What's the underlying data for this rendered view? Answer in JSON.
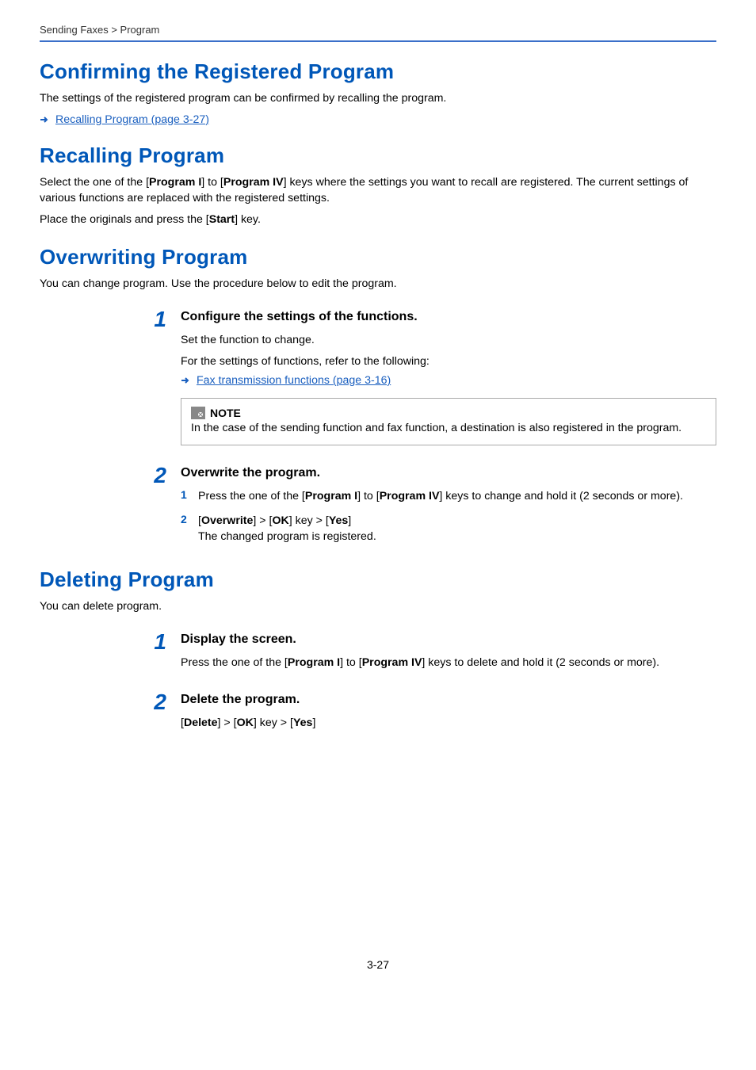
{
  "breadcrumb": "Sending Faxes > Program",
  "section_confirm": {
    "heading": "Confirming the Registered Program",
    "intro": "The settings of the registered program can be confirmed by recalling the program.",
    "link": "Recalling Program (page 3-27)"
  },
  "section_recall": {
    "heading": "Recalling Program",
    "para1_pre": "Select the one of the [",
    "para1_b1": "Program I",
    "para1_mid": "] to [",
    "para1_b2": "Program IV",
    "para1_post": "] keys where the settings you want to recall are registered. The current settings of various functions are replaced with the registered settings.",
    "para2_pre": "Place the originals and press the [",
    "para2_b1": "Start",
    "para2_post": "] key."
  },
  "section_overwrite": {
    "heading": "Overwriting Program",
    "intro": "You can change program. Use the procedure below to edit the program.",
    "step1": {
      "num": "1",
      "title": "Configure the settings of the functions.",
      "line1": "Set the function to change.",
      "line2": "For the settings of functions, refer to the following:",
      "link": "Fax transmission functions (page 3-16)",
      "note_label": "NOTE",
      "note_text": "In the case of the sending function and fax function, a destination is also registered in the program."
    },
    "step2": {
      "num": "2",
      "title": "Overwrite the program.",
      "sub1": {
        "num": "1",
        "pre": "Press the one of the [",
        "b1": "Program I",
        "mid": "] to [",
        "b2": "Program IV",
        "post": "] keys to change and hold it (2 seconds or more)."
      },
      "sub2": {
        "num": "2",
        "l1_open1": "[",
        "l1_b1": "Overwrite",
        "l1_sep1": "] > [",
        "l1_b2": "OK",
        "l1_sep2": "] key > [",
        "l1_b3": "Yes",
        "l1_close": "]",
        "l2": "The changed program is registered."
      }
    }
  },
  "section_delete": {
    "heading": "Deleting Program",
    "intro": "You can delete program.",
    "step1": {
      "num": "1",
      "title": "Display the screen.",
      "pre": "Press the one of the [",
      "b1": "Program I",
      "mid": "] to [",
      "b2": "Program IV",
      "post": "] keys to delete and hold it (2 seconds or more)."
    },
    "step2": {
      "num": "2",
      "title": "Delete the program.",
      "open1": "[",
      "b1": "Delete",
      "sep1": "] > [",
      "b2": "OK",
      "sep2": "] key > [",
      "b3": "Yes",
      "close": "]"
    }
  },
  "page_number": "3-27"
}
